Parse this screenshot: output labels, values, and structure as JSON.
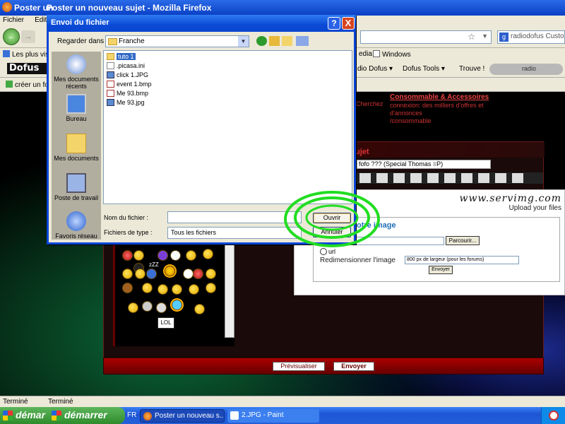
{
  "window": {
    "title_prefix": "Poster un",
    "title": "Poster un nouveau sujet - Mozilla Firefox"
  },
  "menu": [
    "Fichier",
    "Editio"
  ],
  "search": {
    "value": "radiodofus Custom"
  },
  "bookmarks": {
    "items": [
      "Les plus visit",
      "edia",
      "Windows"
    ]
  },
  "toolbar2": {
    "logo": "Dofus",
    "items": [
      "dio Dofus ▾",
      "Dofus Tools ▾",
      "Trouve !"
    ],
    "radio": "radio"
  },
  "toolbar3": {
    "item": "créer un fo"
  },
  "ads": {
    "title": "Consommable & Accessoires",
    "cherchez": "Cherchez",
    "text": "connexion: des milliers d'offres et d'annonces",
    "link": "/consommable"
  },
  "forum": {
    "title_fragment": "ujet",
    "subject": "fofo ??? (Special Thomas =P)"
  },
  "servimg": {
    "logo": "www.servimg.com",
    "tagline": "Upload your files",
    "send_fragment": "otre image",
    "browse": "Parcourir...",
    "url_label": "url",
    "resize_label": "Redimensionner l'image",
    "resize_value": "800 px de largeur (pour les forums)",
    "send": "Envoyer"
  },
  "smileys": {
    "lol": "LOL",
    "zz": "zZZ"
  },
  "post_buttons": {
    "preview": "Prévisualiser",
    "send": "Envoyer"
  },
  "status": {
    "left": "Terminé",
    "right": "Terminé"
  },
  "taskbar": {
    "start": "démarrer",
    "start_partial": "démar",
    "lang": "FR",
    "tasks": [
      "Poster un nouveau s...",
      "2.JPG - Paint"
    ]
  },
  "dialog": {
    "title": "Envoi du fichier",
    "help": "?",
    "close": "X",
    "look_in_label": "Regarder dans :",
    "look_in_value": "Franche",
    "places": [
      "Mes documents récents",
      "Bureau",
      "Mes documents",
      "Poste de travail",
      "Favoris réseau"
    ],
    "files": [
      "tuto 1",
      ".picasa.ini",
      "click 1.JPG",
      "event 1.bmp",
      "Me 93.bmp",
      "Me 93.jpg"
    ],
    "filename_label": "Nom du fichier :",
    "filename_value": "",
    "filetype_label": "Fichiers de type :",
    "filetype_value": "Tous les fichiers",
    "open": "Ouvrir",
    "cancel": "Annuler"
  },
  "colors": {
    "xp_blue": "#0a46d8",
    "highlight": "#316ac5",
    "annotation_circle": "#22dd22"
  }
}
